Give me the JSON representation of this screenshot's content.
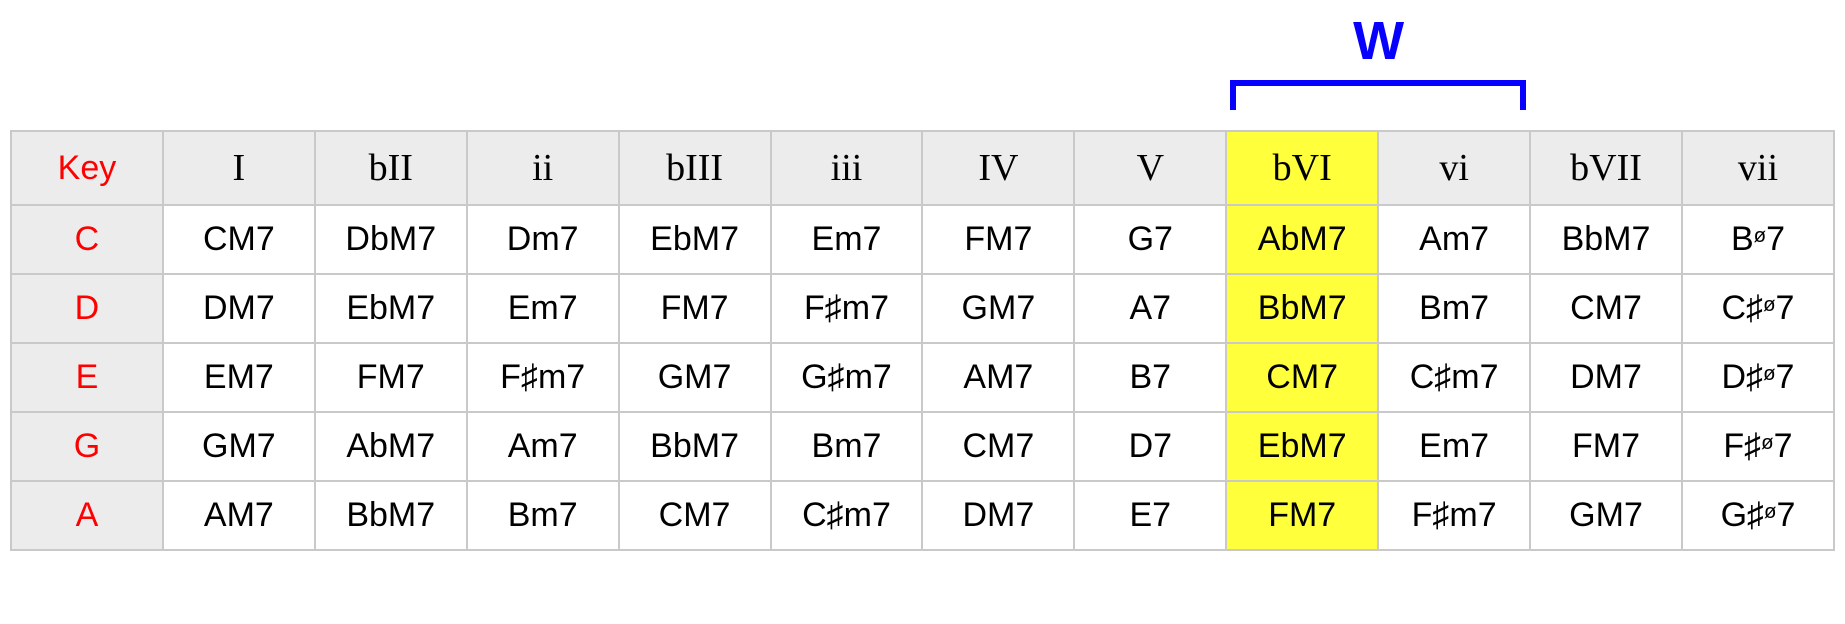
{
  "annotation": {
    "label": "W",
    "bracket_columns": [
      8,
      9
    ]
  },
  "columns": 12,
  "highlight_col_index": 8,
  "headers": [
    "Key",
    "I",
    "bII",
    "ii",
    "bIII",
    "iii",
    "IV",
    "V",
    "bVI",
    "vi",
    "bVII",
    "vii"
  ],
  "rows": [
    {
      "key": "C",
      "cells": [
        "CM7",
        "DbM7",
        "Dm7",
        "EbM7",
        "Em7",
        "FM7",
        "G7",
        "AbM7",
        "Am7",
        "BbM7",
        "B{hd}7"
      ]
    },
    {
      "key": "D",
      "cells": [
        "DM7",
        "EbM7",
        "Em7",
        "FM7",
        "F{sh}m7",
        "GM7",
        "A7",
        "BbM7",
        "Bm7",
        "CM7",
        "C{sh}{hd}7"
      ]
    },
    {
      "key": "E",
      "cells": [
        "EM7",
        "FM7",
        "F{sh}m7",
        "GM7",
        "G{sh}m7",
        "AM7",
        "B7",
        "CM7",
        "C{sh}m7",
        "DM7",
        "D{sh}{hd}7"
      ]
    },
    {
      "key": "G",
      "cells": [
        "GM7",
        "AbM7",
        "Am7",
        "BbM7",
        "Bm7",
        "CM7",
        "D7",
        "EbM7",
        "Em7",
        "FM7",
        "F{sh}{hd}7"
      ]
    },
    {
      "key": "A",
      "cells": [
        "AM7",
        "BbM7",
        "Bm7",
        "CM7",
        "C{sh}m7",
        "DM7",
        "E7",
        "FM7",
        "F{sh}m7",
        "GM7",
        "G{sh}{hd}7"
      ]
    }
  ]
}
